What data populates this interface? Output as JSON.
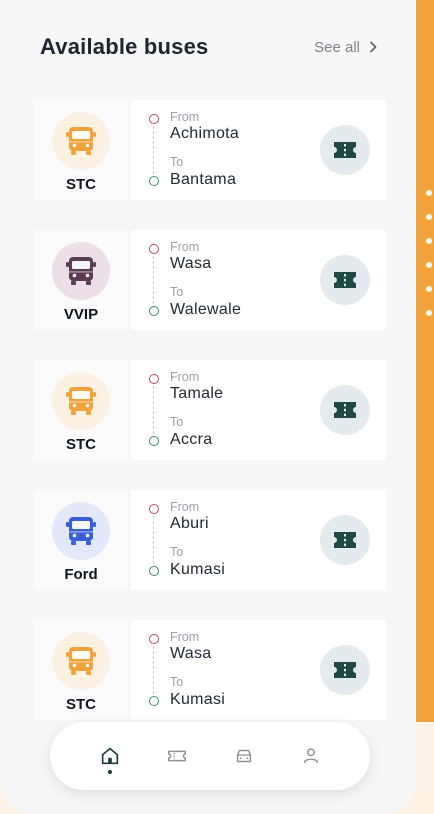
{
  "header": {
    "title": "Available buses",
    "see_all": "See all"
  },
  "labels": {
    "from": "From",
    "to": "To"
  },
  "buses": [
    {
      "operator": "STC",
      "from": "Achimota",
      "to": "Bantama",
      "icon_color": "#f2a23a",
      "circle_color": "#fdf1e3"
    },
    {
      "operator": "VVIP",
      "from": "Wasa",
      "to": "Walewale",
      "icon_color": "#5b3c55",
      "circle_color": "#ecdfe8"
    },
    {
      "operator": "STC",
      "from": "Tamale",
      "to": "Accra",
      "icon_color": "#f2a23a",
      "circle_color": "#fdf1e3"
    },
    {
      "operator": "Ford",
      "from": "Aburi",
      "to": "Kumasi",
      "icon_color": "#3a5fd6",
      "circle_color": "#e3e9fb"
    },
    {
      "operator": "STC",
      "from": "Wasa",
      "to": "Kumasi",
      "icon_color": "#f2a23a",
      "circle_color": "#fdf1e3"
    }
  ],
  "nav": {
    "items": [
      "home-icon",
      "ticket-icon",
      "car-icon",
      "profile-icon"
    ],
    "active": "home-icon"
  },
  "colors": {
    "accent": "#f2a23a",
    "ticket_icon": "#1f4a44",
    "from_node": "#b84a5e",
    "to_node": "#3f8f6b"
  }
}
